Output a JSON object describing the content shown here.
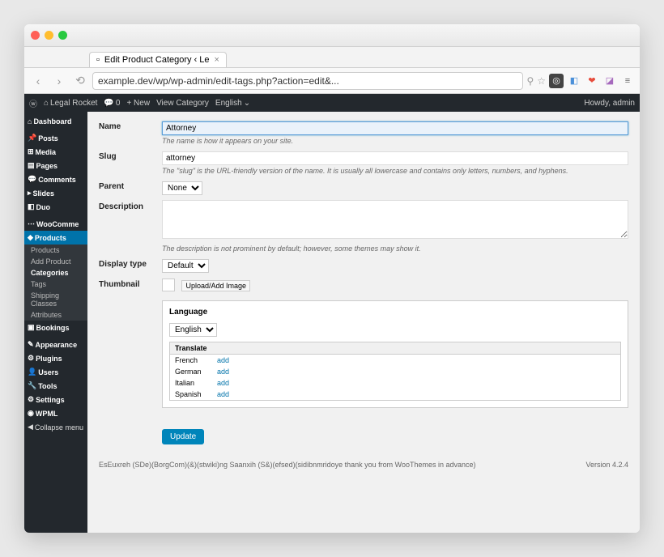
{
  "browser": {
    "tab_title": "Edit Product Category ‹ Le",
    "url": "example.dev/wp/wp-admin/edit-tags.php?action=edit&...",
    "nav": {
      "back": "‹",
      "forward": "›",
      "reload": "⟲"
    },
    "extensions": [
      "⌘",
      "◧",
      "◎",
      "❤",
      "◪",
      "≡"
    ]
  },
  "wp_bar": {
    "site": "Legal Rocket",
    "comments": "0",
    "new": "+ New",
    "view": "View Category",
    "lang_icon": "⌄",
    "lang": "English",
    "howdy": "Howdy, admin"
  },
  "sidebar": {
    "items": [
      {
        "label": "Dashboard",
        "icon": "⌂",
        "bold": true
      },
      {
        "label": "Posts",
        "icon": "✎",
        "bold": true
      },
      {
        "label": "Media",
        "icon": "⊞",
        "bold": true
      },
      {
        "label": "Pages",
        "icon": "▤",
        "bold": true
      },
      {
        "label": "Comments",
        "icon": "✉",
        "bold": true
      },
      {
        "label": "Slides",
        "icon": "▸",
        "bold": true
      },
      {
        "label": "Duo",
        "icon": "◧",
        "bold": true
      },
      {
        "label": "WooComme",
        "icon": "⋯",
        "bold": true
      },
      {
        "label": "Products",
        "icon": "◆",
        "bold": true,
        "current": true
      },
      {
        "label": "Bookings",
        "icon": "▣",
        "bold": true
      },
      {
        "label": "Appearance",
        "icon": "✎",
        "bold": true
      },
      {
        "label": "Plugins",
        "icon": "⚙",
        "bold": true
      },
      {
        "label": "Users",
        "icon": "👤",
        "bold": true
      },
      {
        "label": "Tools",
        "icon": "🔧",
        "bold": true
      },
      {
        "label": "Settings",
        "icon": "⚙",
        "bold": true
      },
      {
        "label": "WPML",
        "icon": "◉",
        "bold": true
      },
      {
        "label": "Collapse menu",
        "icon": "◀",
        "bold": false
      }
    ],
    "products_sub": [
      {
        "label": "Products"
      },
      {
        "label": "Add Product"
      },
      {
        "label": "Categories",
        "active": true
      },
      {
        "label": "Tags"
      },
      {
        "label": "Shipping Classes"
      },
      {
        "label": "Attributes"
      }
    ]
  },
  "form": {
    "name": {
      "label": "Name",
      "value": "Attorney",
      "help": "The name is how it appears on your site."
    },
    "slug": {
      "label": "Slug",
      "value": "attorney",
      "help": "The \"slug\" is the URL-friendly version of the name. It is usually all lowercase and contains only letters, numbers, and hyphens."
    },
    "parent": {
      "label": "Parent",
      "value": "None"
    },
    "description": {
      "label": "Description",
      "value": "",
      "help": "The description is not prominent by default; however, some themes may show it."
    },
    "display_type": {
      "label": "Display type",
      "value": "Default"
    },
    "thumbnail": {
      "label": "Thumbnail",
      "upload": "Upload/Add Image"
    },
    "language": {
      "title": "Language",
      "selected": "English",
      "translate_header": "Translate",
      "translations": [
        {
          "lang": "French",
          "action": "add"
        },
        {
          "lang": "German",
          "action": "add"
        },
        {
          "lang": "Italian",
          "action": "add"
        },
        {
          "lang": "Spanish",
          "action": "add"
        }
      ]
    },
    "update": "Update"
  },
  "footer": {
    "left": "EsEuxreh (SDe)(BorgCom)(&)(stwiki)ng Saanxih (S&)(efsed)(sidibnmridoye thank you from WooThemes in advance)",
    "right": "Version 4.2.4"
  }
}
